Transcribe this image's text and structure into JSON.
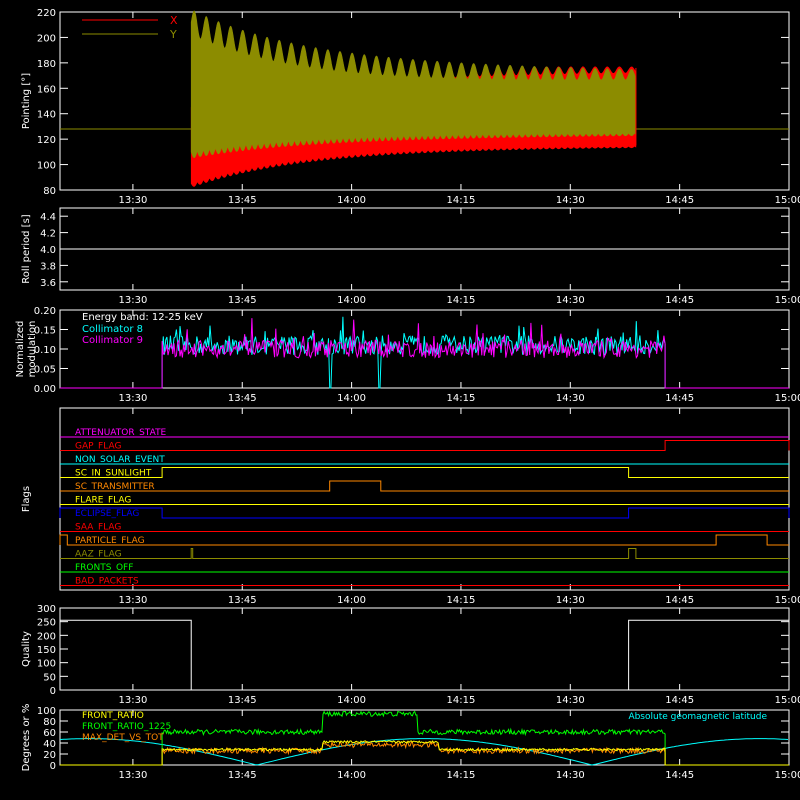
{
  "x_ticks": [
    "13:30",
    "13:45",
    "14:00",
    "14:15",
    "14:30",
    "14:45",
    "15:00"
  ],
  "chart_data": [
    {
      "type": "line",
      "ylabel": "Pointing [°]",
      "ylim": [
        80,
        220
      ],
      "yticks": [
        "80",
        "100",
        "120",
        "140",
        "160",
        "180",
        "200",
        "220"
      ],
      "x_range": [
        "13:20",
        "15:00"
      ],
      "legend_position": "top-left",
      "series": [
        {
          "name": "X",
          "color": "#ff0000",
          "start": "13:38",
          "end": "14:39",
          "outside_value": 128,
          "initial_range": [
            85,
            145
          ],
          "final_range": [
            115,
            175
          ]
        },
        {
          "name": "Y",
          "color": "#8c8c00",
          "start": "13:38",
          "end": "14:39",
          "outside_value": 128,
          "initial_range": [
            110,
            212
          ],
          "final_range": [
            125,
            170
          ]
        }
      ]
    },
    {
      "type": "line",
      "ylabel": "Roll period [s]",
      "ylim": [
        3.5,
        4.5
      ],
      "yticks": [
        "3.6",
        "3.8",
        "4.0",
        "4.2",
        "4.4"
      ],
      "series": [
        {
          "name": "",
          "color": "#ffffff",
          "value": 4.0
        }
      ]
    },
    {
      "type": "line",
      "ylabel": "Normalized\nmodulation",
      "ylim": [
        0,
        0.2
      ],
      "yticks": [
        "0.00",
        "0.05",
        "0.10",
        "0.15",
        "0.20"
      ],
      "annotation": "Energy band: 12-25 keV",
      "series": [
        {
          "name": "Collimator 8",
          "color": "#00ffff",
          "start": "13:34",
          "end": "14:43",
          "mean": 0.11,
          "dropouts": [
            [
              "13:57",
              "14:04"
            ]
          ]
        },
        {
          "name": "Collimator 9",
          "color": "#ff00ff",
          "start": "13:34",
          "end": "14:43",
          "mean": 0.1
        }
      ]
    },
    {
      "type": "step",
      "ylabel": "Flags",
      "flags": [
        {
          "name": "ATTENUATOR_STATE",
          "color": "#ff00ff",
          "segments": []
        },
        {
          "name": "GAP_FLAG",
          "color": "#ff0000",
          "segments": [
            [
              "14:43",
              "15:00"
            ]
          ]
        },
        {
          "name": "NON_SOLAR_EVENT",
          "color": "#00ffff",
          "segments": []
        },
        {
          "name": "SC_IN_SUNLIGHT",
          "color": "#ffff00",
          "segments": [
            [
              "13:34",
              "14:38"
            ]
          ]
        },
        {
          "name": "SC_TRANSMITTER",
          "color": "#ff8800",
          "segments": [
            [
              "13:57",
              "14:04"
            ]
          ]
        },
        {
          "name": "FLARE_FLAG",
          "color": "#ffff00",
          "segments": []
        },
        {
          "name": "ECLIPSE_FLAG",
          "color": "#0000ff",
          "segments": [
            [
              "13:20",
              "13:34"
            ],
            [
              "14:38",
              "15:00"
            ]
          ]
        },
        {
          "name": "SAA_FLAG",
          "color": "#ff0000",
          "segments": []
        },
        {
          "name": "PARTICLE_FLAG",
          "color": "#ff8800",
          "segments": [
            [
              "13:20",
              "13:21"
            ],
            [
              "14:50",
              "14:57"
            ]
          ]
        },
        {
          "name": "AAZ_FLAG",
          "color": "#8c8c00",
          "segments": [
            [
              "13:38",
              "13:38"
            ],
            [
              "14:38",
              "14:39"
            ]
          ]
        },
        {
          "name": "FRONTS_OFF",
          "color": "#00ff00",
          "segments": []
        },
        {
          "name": "BAD_PACKETS",
          "color": "#ff0000",
          "segments": []
        }
      ]
    },
    {
      "type": "step",
      "ylabel": "Quality",
      "ylim": [
        0,
        300
      ],
      "yticks": [
        "0",
        "50",
        "100",
        "150",
        "200",
        "250",
        "300"
      ],
      "series": [
        {
          "name": "",
          "color": "#ffffff",
          "high": 255,
          "segments_high": [
            [
              "13:20",
              "13:38"
            ],
            [
              "14:38",
              "15:00"
            ]
          ]
        }
      ]
    },
    {
      "type": "line",
      "ylabel": "Degrees or %",
      "ylim": [
        0,
        100
      ],
      "yticks": [
        "0",
        "20",
        "40",
        "60",
        "80",
        "100"
      ],
      "annotation": "Absolute geomagnetic latitude",
      "annotation_color": "#00ffff",
      "series": [
        {
          "name": "FRONT_RATIO",
          "color": "#ffff00",
          "start": "13:34",
          "end": "14:43",
          "base": 28,
          "hump": [
            [
              "13:56",
              "14:12"
            ],
            42
          ]
        },
        {
          "name": "FRONT_RATIO_1225",
          "color": "#00ff00",
          "start": "13:34",
          "end": "14:43",
          "base": 60,
          "hump": [
            [
              "13:56",
              "14:09"
            ],
            93
          ]
        },
        {
          "name": "MAX_DET_VS_TOT",
          "color": "#ff8800",
          "start": "13:34",
          "end": "14:43",
          "base": 26,
          "hump": [
            [
              "13:56",
              "14:12"
            ],
            37
          ]
        },
        {
          "name": "Absolute geomagnetic latitude",
          "color": "#00ffff",
          "min": 0,
          "max": 48
        }
      ]
    }
  ]
}
